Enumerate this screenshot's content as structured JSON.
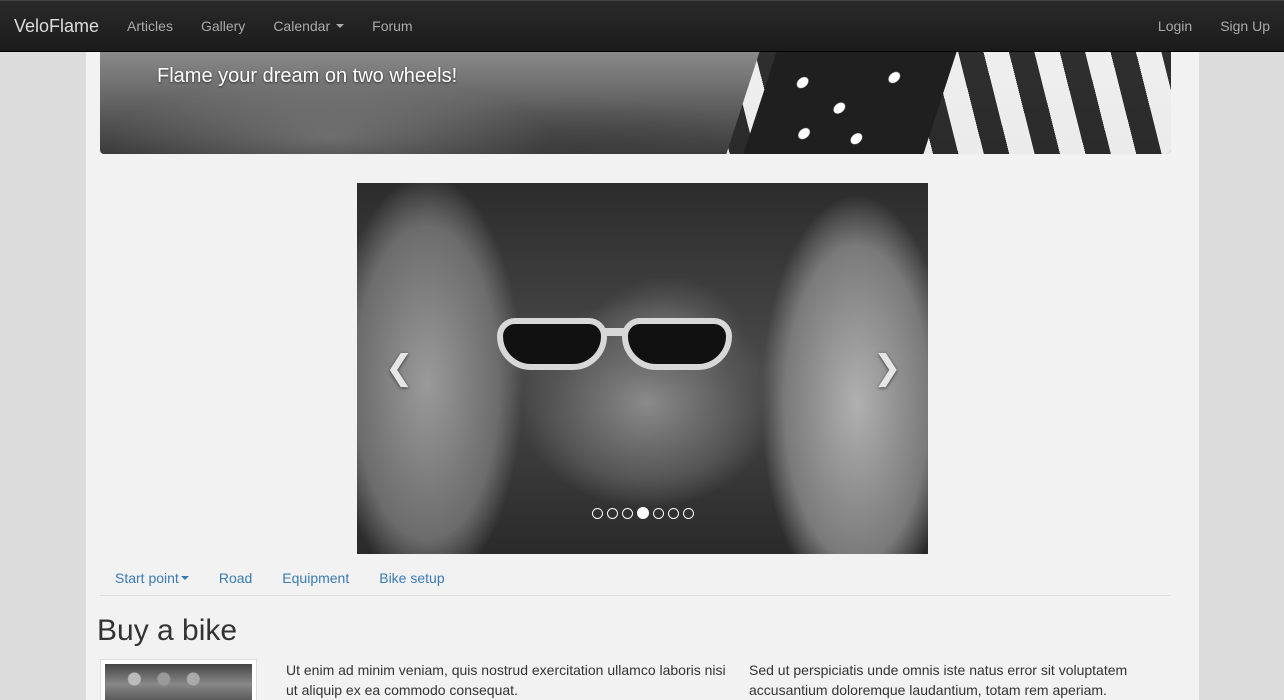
{
  "navbar": {
    "brand": "VeloFlame",
    "items": [
      {
        "label": "Articles"
      },
      {
        "label": "Gallery"
      },
      {
        "label": "Calendar"
      },
      {
        "label": "Forum"
      }
    ],
    "right": [
      {
        "label": "Login"
      },
      {
        "label": "Sign Up"
      }
    ]
  },
  "banner": {
    "tagline": "Flame your dream on two wheels!"
  },
  "carousel": {
    "prev_icon": "chevron-left-icon",
    "next_icon": "chevron-right-icon",
    "slide_count": 7,
    "active_slide": 4
  },
  "subnav": {
    "items": [
      {
        "label": "Start point"
      },
      {
        "label": "Road"
      },
      {
        "label": "Equipment"
      },
      {
        "label": "Bike setup"
      }
    ]
  },
  "section": {
    "title": "Buy a bike",
    "paragraph_1": "Ut enim ad minim veniam, quis nostrud exercitation ullamco laboris nisi ut aliquip ex ea commodo consequat.",
    "paragraph_2": "Sed ut perspiciatis unde omnis iste natus error sit voluptatem accusantium doloremque laudantium, totam rem aperiam."
  },
  "colors": {
    "navbar_bg": "#1b1b1b",
    "link": "#3a7ab5",
    "page_bg": "#f2f2f2"
  }
}
